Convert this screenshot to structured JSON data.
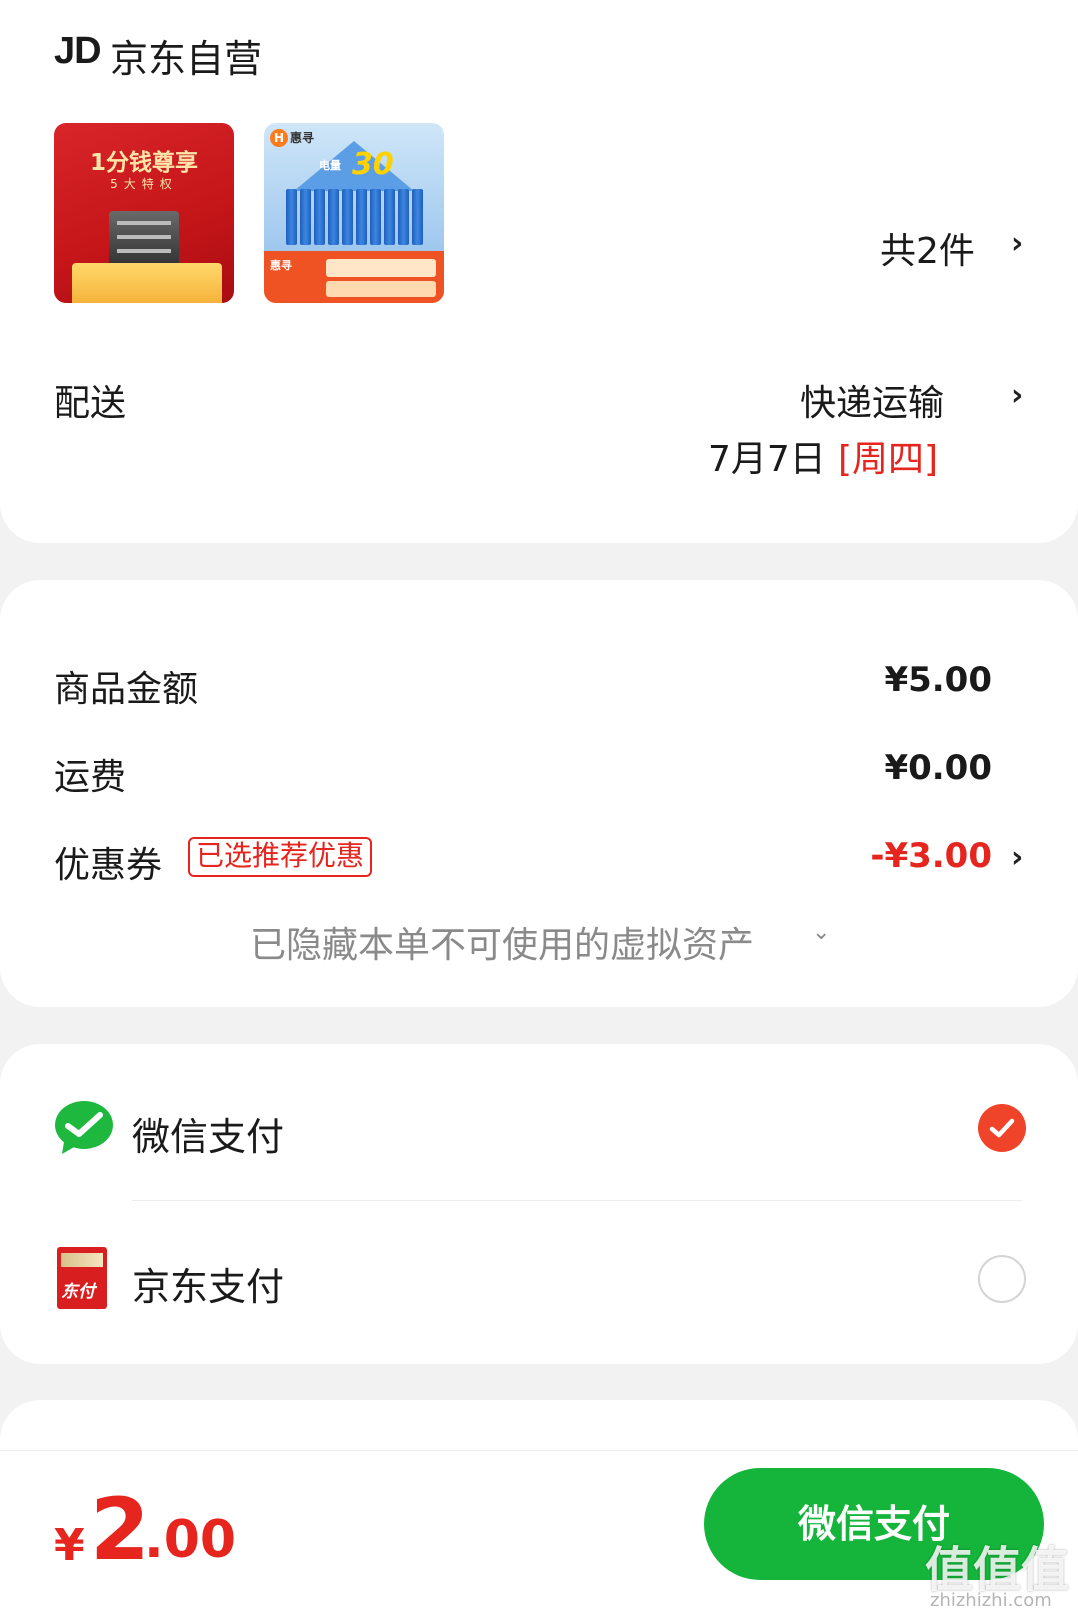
{
  "shop": {
    "logo_text": "JD",
    "name": "京东自营"
  },
  "items": {
    "count_label": "共2件"
  },
  "delivery": {
    "label": "配送",
    "method": "快递运输",
    "date": "7月7日",
    "weekday": "[周四]"
  },
  "cost": {
    "goods_label": "商品金额",
    "goods_value": "¥5.00",
    "shipping_label": "运费",
    "shipping_value": "¥0.00",
    "coupon_label": "优惠券",
    "coupon_tag": "已选推荐优惠",
    "coupon_value": "-¥3.00",
    "hidden_assets_label": "已隐藏本单不可使用的虚拟资产"
  },
  "payment": {
    "options": [
      {
        "label": "微信支付",
        "selected": true,
        "icon": "wechat-pay-icon"
      },
      {
        "label": "京东支付",
        "selected": false,
        "icon": "jd-pay-icon",
        "icon_text": "东付"
      }
    ]
  },
  "footer": {
    "currency": "¥",
    "total_int": "2",
    "total_dec": ".00",
    "submit_label": "微信支付"
  },
  "thumbnails": {
    "thumb1_title": "1分钱尊享",
    "thumb1_sub": "5大特权",
    "thumb2_brand": "惠寻",
    "thumb2_big": "30",
    "thumb2_small": "电量"
  },
  "watermark": {
    "text": "值值值",
    "url": "zhizhizhi.com"
  },
  "colors": {
    "accent_red": "#e5251e",
    "wechat_green": "#14b53a",
    "selected_radio": "#f0442a",
    "background": "#f2f2f2"
  }
}
